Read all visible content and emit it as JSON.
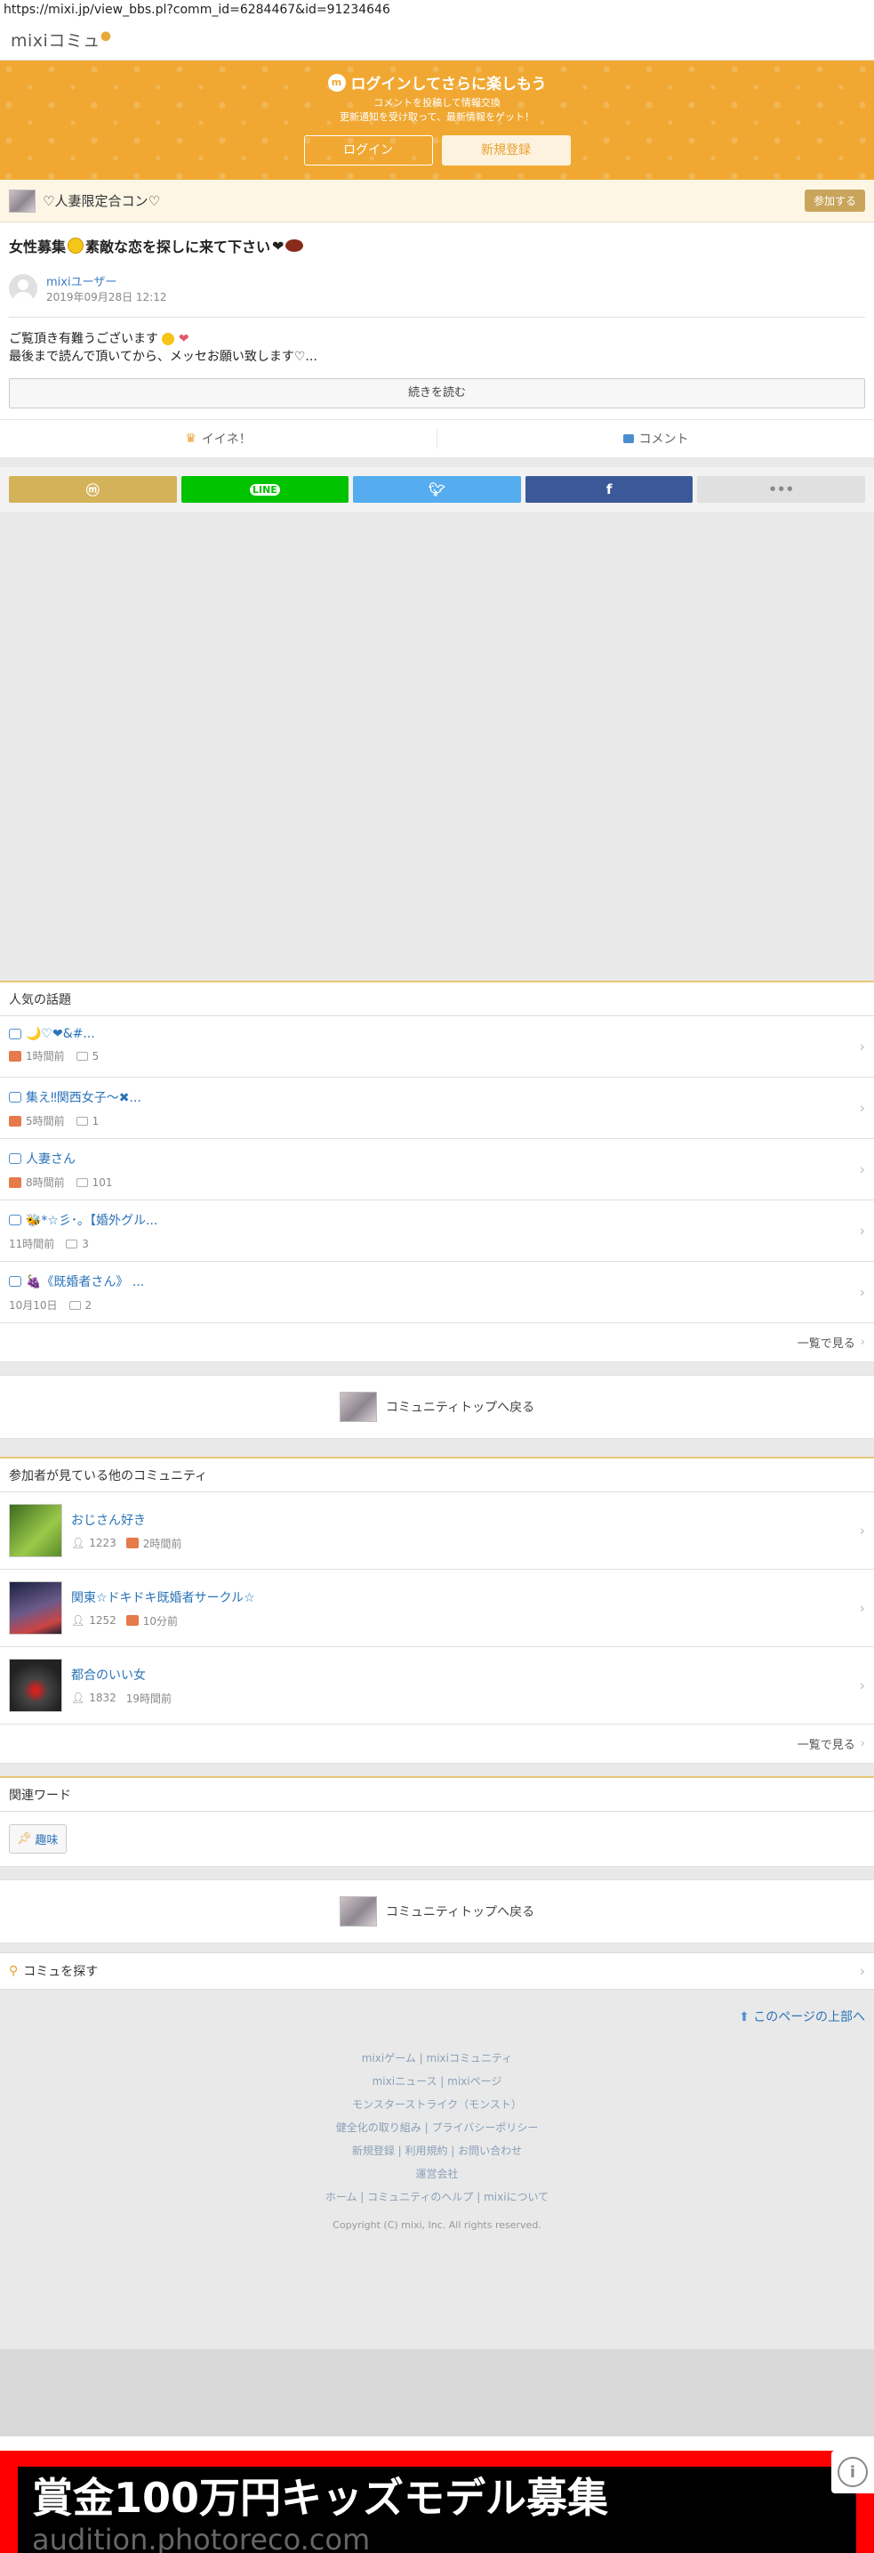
{
  "url": "https://mixi.jp/view_bbs.pl?comm_id=6284467&id=91234646",
  "brand": "mixiコミュ",
  "banner": {
    "title": "ログインしてさらに楽しもう",
    "sub1": "コメントを投稿して情報交換",
    "sub2": "更新通知を受け取って、最新情報をゲット！",
    "login": "ログイン",
    "signup": "新規登録"
  },
  "community": {
    "name": "♡人妻限定合コン♡",
    "join": "参加する"
  },
  "post": {
    "title_pre": "女性募集",
    "title_post": "素敵な恋を探しに来て下さい",
    "author": "mixiユーザー",
    "date": "2019年09月28日 12:12",
    "body1": "ご覧頂き有難うございます",
    "body2": "最後まで読んで頂いてから、メッセお願い致します♡...",
    "read_more": "続きを読む"
  },
  "actions": {
    "like": "イイネ！",
    "comment": "コメント"
  },
  "share_colors": {
    "mixi": "#d4b25a",
    "line": "#00c300",
    "twitter": "#55acee",
    "facebook": "#3b5998",
    "more": "#e0e0e0"
  },
  "popular": {
    "heading": "人気の話題",
    "topics": [
      {
        "title": "🌙♡❤&#...",
        "time": "1時間前",
        "count": "5"
      },
      {
        "title": "集え‼関西女子〜✖...",
        "time": "5時間前",
        "count": "1"
      },
      {
        "title": "人妻さん",
        "time": "8時間前",
        "count": "101"
      },
      {
        "title": "🐝*☆彡･｡【婚外グル...",
        "time": "11時間前",
        "count": "3"
      },
      {
        "title": "🍇《既婚者さん》 ...",
        "time": "10月10日",
        "count": "2"
      }
    ],
    "see_all": "一覧で見る"
  },
  "back_to_top": "コミュニティトップへ戻る",
  "others": {
    "heading": "参加者が見ている他のコミュニティ",
    "items": [
      {
        "title": "おじさん好き",
        "members": "1223",
        "time": "2時間前"
      },
      {
        "title": "関東☆ドキドキ既婚者サークル☆",
        "members": "1252",
        "time": "10分前"
      },
      {
        "title": "都合のいい女",
        "members": "1832",
        "time": "19時間前"
      }
    ],
    "see_all": "一覧で見る"
  },
  "related": {
    "heading": "関連ワード",
    "tag": "趣味"
  },
  "search": "コミュを探す",
  "footer": {
    "pagetop": "このページの上部へ",
    "lines": [
      "mixiゲーム | mixiコミュニティ",
      "mixiニュース | mixiページ",
      "モンスターストライク（モンスト）",
      "健全化の取り組み | プライバシーポリシー",
      "新規登録 | 利用規約 | お問い合わせ",
      "運営会社",
      "ホーム | コミュニティのヘルプ | mixiについて"
    ],
    "copyright": "Copyright (C) mixi, Inc. All rights reserved."
  },
  "ad": {
    "headline": "賞金100万円キッズモデル募集",
    "url": "audition.photoreco.com"
  }
}
